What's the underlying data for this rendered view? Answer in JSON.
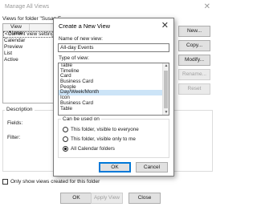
{
  "background_dialog": {
    "title": "Manage All Views",
    "close_glyph": "✕",
    "views_label": "Views for folder \"Susan F",
    "list_headers": [
      "View Name",
      ""
    ],
    "views": [
      {
        "label": "<Current view settings>",
        "current": true
      },
      {
        "label": "Calendar"
      },
      {
        "label": "Preview"
      },
      {
        "label": "List"
      },
      {
        "label": "Active"
      }
    ],
    "side_buttons": {
      "new": "New...",
      "copy": "Copy...",
      "modify": "Modify...",
      "rename": "Rename...",
      "reset": "Reset"
    },
    "description_label": "Description",
    "fields_label": "Fields:",
    "filter_label": "Filter:",
    "checkbox_label": "Only show views created for this folder",
    "bottom_buttons": {
      "ok": "OK",
      "apply_view": "Apply View",
      "close": "Close"
    }
  },
  "dialog": {
    "title": "Create a New View",
    "close_glyph": "✕",
    "name_label": "Name of new view:",
    "name_value": "All-day Events",
    "type_label": "Type of view:",
    "types": [
      "Table",
      "Timeline",
      "Card",
      "Business Card",
      "People",
      "Day/Week/Month",
      "Icon",
      "Business Card",
      "Table"
    ],
    "selected_type_index": 5,
    "can_be_used_label": "Can be used on",
    "radio_options": [
      {
        "label": "This folder, visible to everyone",
        "checked": false
      },
      {
        "label": "This folder, visible only to me",
        "checked": false
      },
      {
        "label": "All Calendar folders",
        "checked": true
      }
    ],
    "ok_label": "OK",
    "cancel_label": "Cancel"
  },
  "colors": {
    "selection": "#cce4f7",
    "default_button_border": "#0078d7"
  }
}
